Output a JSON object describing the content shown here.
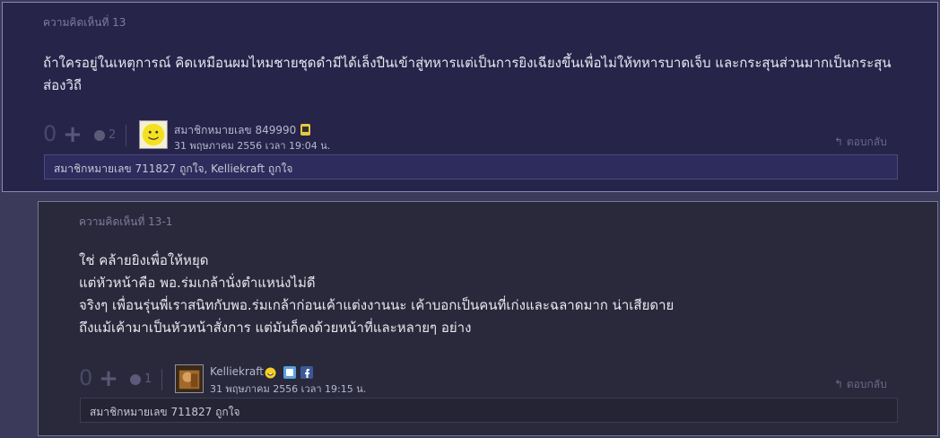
{
  "comments": [
    {
      "header": "ความคิดเห็นที่ 13",
      "lines": [
        "ถ้าใครอยู่ในเหตุการณ์ คิดเหมือนผมไหมชายชุดดำมีได้เล็งปืนเข้าสู่ทหารแต่เป็นการยิงเฉียงขึ้นเพื่อไม่ให้ทหารบาดเจ็บ  และกระสุนส่วนมากเป็นกระสุน",
        "ส่องวิถี"
      ],
      "votes": "0",
      "emotion_count": "2",
      "user": "สมาชิกหมายเลข 849990",
      "timestamp": "31 พฤษภาคม 2556 เวลา 19:04 น.",
      "reply_label": "ตอบกลับ",
      "likes": "สมาชิกหมายเลข 711827 ถูกใจ, Kelliekraft ถูกใจ"
    },
    {
      "header": "ความคิดเห็นที่ 13-1",
      "lines": [
        "ใช่ คล้ายยิงเพื่อให้หยุด",
        "แต่หัวหน้าคือ พอ.ร่มเกล้านั่งตำแหน่งไม่ดี",
        "จริงๆ เพื่อนรุ่นพี่เราสนิทกับพอ.ร่มเกล้าก่อนเค้าแต่งงานนะ เค้าบอกเป็นคนที่เก่งและฉลาดมาก น่าเสียดาย",
        "ถึงแม้เค้ามาเป็นหัวหน้าสั่งการ แต่มันก็คงด้วยหน้าที่และหลายๆ อย่าง"
      ],
      "votes": "0",
      "emotion_count": "1",
      "user": "Kelliekraft",
      "timestamp": "31 พฤษภาคม 2556 เวลา 19:15 น.",
      "reply_label": "ตอบกลับ",
      "likes": "สมาชิกหมายเลข 711827 ถูกใจ"
    }
  ],
  "icons": {
    "plus": "plus-icon",
    "emotion": "emotion-icon",
    "reply": "reply-arrow-icon",
    "twitter": "twitter-icon",
    "facebook": "facebook-icon"
  },
  "colors": {
    "page_bg": "#3b3a5a",
    "comment1_bg": "#262449",
    "comment2_bg": "#29293b",
    "text": "#e8e8f0",
    "muted": "#7e7ca0"
  }
}
